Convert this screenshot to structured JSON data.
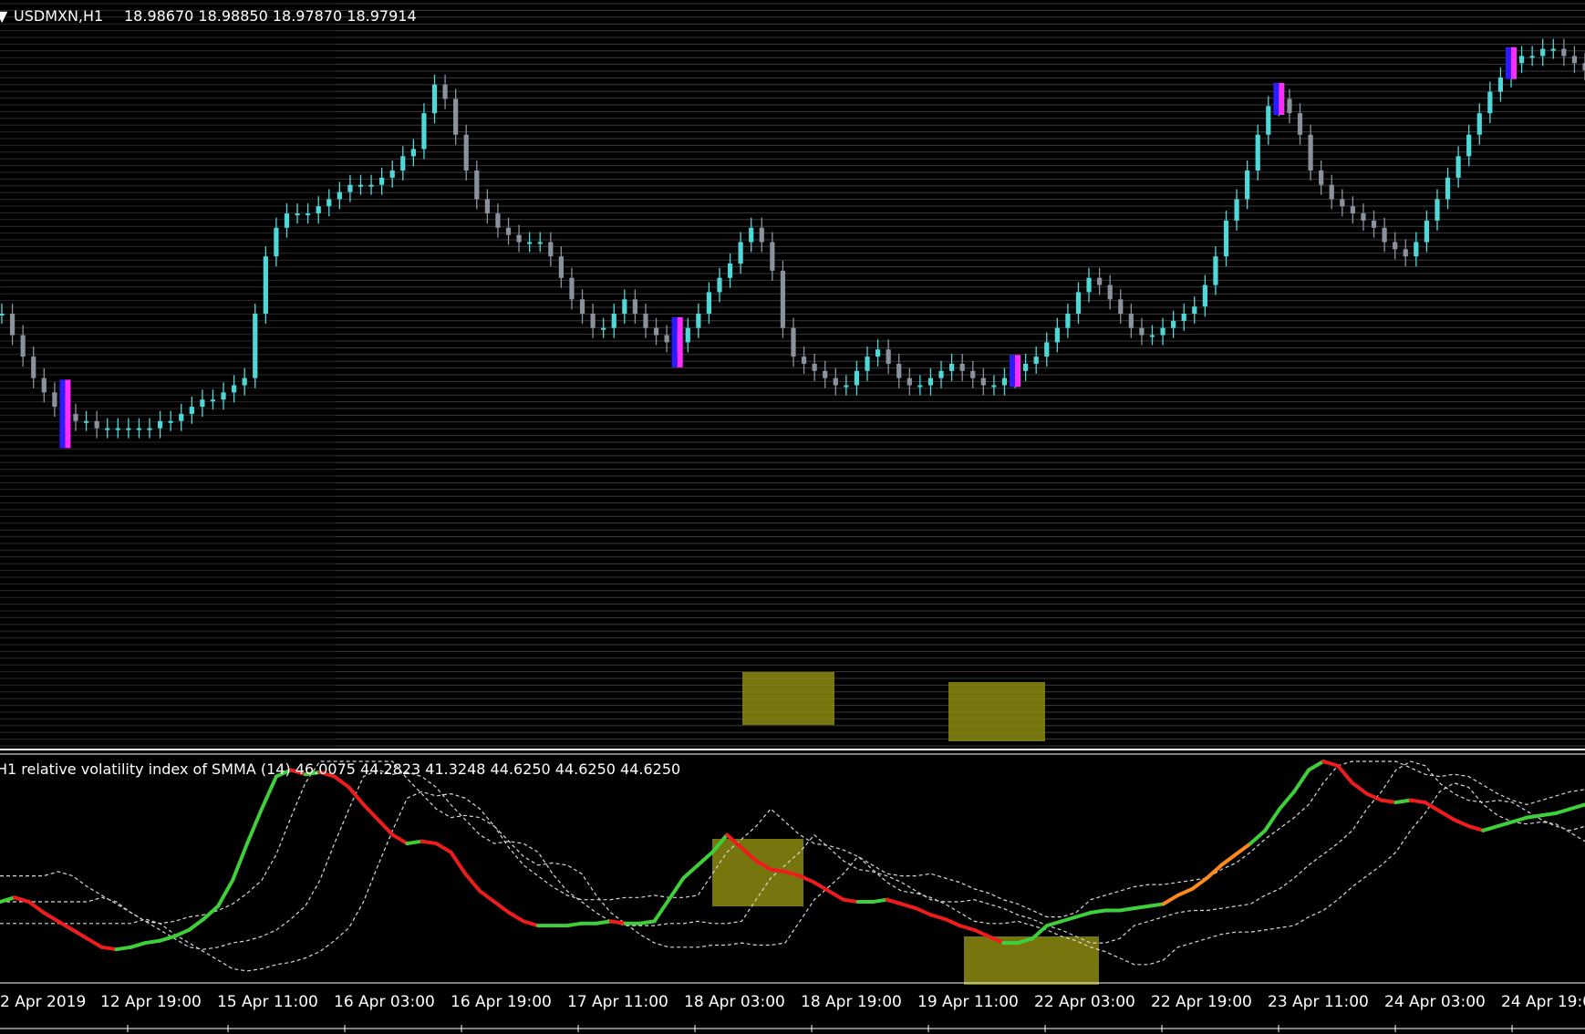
{
  "header": {
    "caret": "▼",
    "symbol": "USDMXN,H1",
    "ohlc": "18.98670 18.98850 18.97870 18.97914"
  },
  "indicator": {
    "label": "H1 relative volatility index of SMMA (14) 46.0075 44.2823 41.3248 44.6250 44.6250 44.6250"
  },
  "colors": {
    "background": "#000000",
    "grid_stripe": "#3c3c3c",
    "bull_candle": "#4fd8d8",
    "bear_candle": "#8a929c",
    "marker_blue": "#2b1cff",
    "marker_magenta": "#ff2bff",
    "highlight_box": "#8c8a10",
    "rvi_up": "#3fcf3a",
    "rvi_down": "#ee1c1c",
    "rvi_orange": "#ff8a1c",
    "bands": "#d8d8d8",
    "separator": "#ffffff"
  },
  "chart_data": [
    {
      "type": "line",
      "title": "USDMXN,H1",
      "description_source": "candlestick price chart",
      "x_labels": [
        "2 Apr 2019",
        "12 Apr 19:00",
        "15 Apr 11:00",
        "16 Apr 03:00",
        "16 Apr 19:00",
        "17 Apr 11:00",
        "18 Apr 03:00",
        "18 Apr 19:00",
        "19 Apr 11:00",
        "22 Apr 03:00",
        "22 Apr 19:00",
        "23 Apr 11:00",
        "24 Apr 03:00",
        "24 Apr 19:0"
      ],
      "ylim": [
        0,
        100
      ],
      "series": [
        {
          "values": [
            60,
            57,
            54,
            51,
            49,
            47,
            46,
            45,
            45,
            44,
            44,
            44,
            44,
            44,
            44,
            45,
            45,
            46,
            47,
            48,
            48,
            49,
            50,
            51,
            60,
            68,
            72,
            74,
            74,
            74,
            75,
            76,
            77,
            78,
            78,
            78,
            79,
            80,
            82,
            83,
            88,
            92,
            90,
            85,
            80,
            76,
            74,
            72,
            71,
            70,
            70,
            70,
            68,
            65,
            62,
            60,
            58,
            58,
            60,
            62,
            60,
            58,
            57,
            56,
            56,
            58,
            60,
            63,
            65,
            67,
            70,
            72,
            70,
            66,
            58,
            54,
            53,
            52,
            51,
            50,
            50,
            52,
            54,
            55,
            53,
            51,
            50,
            50,
            51,
            52,
            53,
            52,
            51,
            50,
            50,
            51,
            52,
            53,
            54,
            56,
            58,
            60,
            63,
            65,
            64,
            62,
            60,
            58,
            57,
            57,
            58,
            59,
            60,
            61,
            64,
            68,
            73,
            76,
            80,
            85,
            89,
            90,
            88,
            85,
            80,
            78,
            76,
            75,
            74,
            73,
            72,
            70,
            69,
            68,
            70,
            73,
            76,
            79,
            82,
            85,
            88,
            91,
            93,
            95,
            96,
            96,
            97,
            97,
            96,
            95,
            94
          ]
        }
      ]
    },
    {
      "type": "line",
      "title": "relative volatility index of SMMA (14)",
      "x_labels": [
        "2 Apr 2019",
        "12 Apr 19:00",
        "15 Apr 11:00",
        "16 Apr 03:00",
        "16 Apr 19:00",
        "17 Apr 11:00",
        "18 Apr 03:00",
        "18 Apr 19:00",
        "19 Apr 11:00",
        "22 Apr 03:00",
        "22 Apr 19:00",
        "23 Apr 11:00",
        "24 Apr 03:00",
        "24 Apr 19:0"
      ],
      "ylim": [
        0,
        100
      ],
      "last_values": [
        46.0075,
        44.2823,
        41.3248,
        44.625,
        44.625,
        44.625
      ],
      "series": [
        {
          "values": [
            35,
            37,
            35,
            30,
            26,
            22,
            18,
            14,
            13,
            14,
            16,
            17,
            19,
            22,
            27,
            33,
            45,
            62,
            78,
            93,
            96,
            94,
            95,
            93,
            88,
            80,
            73,
            66,
            62,
            63,
            62,
            58,
            48,
            40,
            35,
            30,
            26,
            24,
            24,
            24,
            25,
            25,
            26,
            25,
            25,
            26,
            36,
            46,
            52,
            58,
            66,
            60,
            54,
            50,
            49,
            47,
            44,
            40,
            36,
            35,
            35,
            36,
            34,
            32,
            29,
            27,
            24,
            22,
            19,
            16,
            16,
            18,
            24,
            26,
            28,
            30,
            31,
            31,
            32,
            33,
            34,
            38,
            41,
            46,
            52,
            57,
            62,
            68,
            78,
            86,
            96,
            100,
            98,
            90,
            85,
            82,
            81,
            82,
            81,
            77,
            73,
            70,
            68,
            70,
            72,
            74,
            75,
            76,
            78,
            80
          ]
        }
      ]
    }
  ]
}
